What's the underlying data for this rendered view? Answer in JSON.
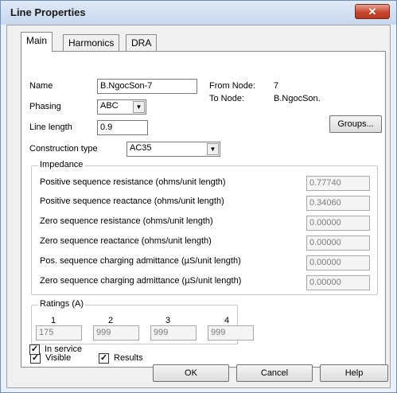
{
  "window": {
    "title": "Line Properties",
    "close_glyph": "✕"
  },
  "tabs": [
    "Main",
    "Harmonics",
    "DRA"
  ],
  "main": {
    "name_label": "Name",
    "name_value": "B.NgocSon-7",
    "from_node_label": "From Node:",
    "from_node_value": "7",
    "to_node_label": "To Node:",
    "to_node_value": "B.NgocSon.",
    "phasing_label": "Phasing",
    "phasing_value": "ABC",
    "line_length_label": "Line length",
    "line_length_value": "0.9",
    "groups_button": "Groups...",
    "construction_type_label": "Construction type",
    "construction_type_value": "AC35"
  },
  "impedance": {
    "legend": "Impedance",
    "rows": [
      {
        "label": "Positive sequence resistance (ohms/unit length)",
        "value": "0.77740"
      },
      {
        "label": "Positive sequence reactance (ohms/unit length)",
        "value": "0.34060"
      },
      {
        "label": "Zero sequence resistance (ohms/unit length)",
        "value": "0.00000"
      },
      {
        "label": "Zero sequence reactance (ohms/unit length)",
        "value": "0.00000"
      },
      {
        "label": "Pos. sequence charging admittance (µS/unit length)",
        "value": "0.00000"
      },
      {
        "label": "Zero sequence charging admittance (µS/unit length)",
        "value": "0.00000"
      }
    ]
  },
  "ratings": {
    "legend": "Ratings (A)",
    "headers": [
      "1",
      "2",
      "3",
      "4"
    ],
    "values": [
      "175",
      "999",
      "999",
      "999"
    ]
  },
  "checkboxes": {
    "visible": {
      "label": "Visible",
      "checked": true
    },
    "results": {
      "label": "Results",
      "checked": true
    },
    "in_service": {
      "label": "In service",
      "checked": true
    }
  },
  "buttons": {
    "ok": "OK",
    "cancel": "Cancel",
    "help": "Help"
  },
  "icons": {
    "dropdown_arrow": "▼",
    "check_mark": "✓"
  }
}
